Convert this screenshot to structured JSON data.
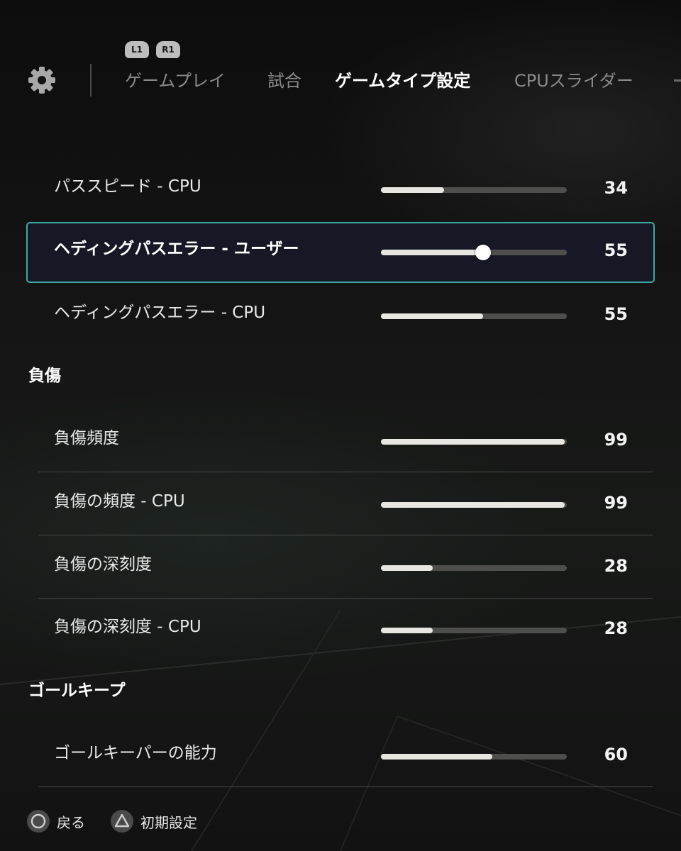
{
  "tabs": {
    "shoulder_left": "L1",
    "shoulder_right": "R1",
    "items": [
      {
        "label": "ゲームプレイ",
        "active": false
      },
      {
        "label": "試合",
        "active": false
      },
      {
        "label": "ゲームタイプ設定",
        "active": true
      },
      {
        "label": "CPUスライダー",
        "active": false
      }
    ]
  },
  "settings": [
    {
      "label": "パススピード - CPU",
      "value": "34",
      "fill": 0.34,
      "selected": false
    },
    {
      "label": "ヘディングパスエラー - ユーザー",
      "value": "55",
      "fill": 0.55,
      "selected": true
    },
    {
      "label": "ヘディングパスエラー - CPU",
      "value": "55",
      "fill": 0.55,
      "selected": false
    }
  ],
  "sections": [
    {
      "title": "負傷",
      "rows": [
        {
          "label": "負傷頻度",
          "value": "99",
          "fill": 0.99
        },
        {
          "label": "負傷の頻度 - CPU",
          "value": "99",
          "fill": 0.99
        },
        {
          "label": "負傷の深刻度",
          "value": "28",
          "fill": 0.28
        },
        {
          "label": "負傷の深刻度 - CPU",
          "value": "28",
          "fill": 0.28
        }
      ]
    },
    {
      "title": "ゴールキープ",
      "rows": [
        {
          "label": "ゴールキーパーの能力",
          "value": "60",
          "fill": 0.6
        }
      ]
    }
  ],
  "footer": {
    "back_label": "戻る",
    "back_icon": "circle-button-icon",
    "reset_label": "初期設定",
    "reset_icon": "triangle-button-icon"
  },
  "colors": {
    "accent_border": "#3fa9a4",
    "slider_fill": "#e8e6e0",
    "slider_track": "#4e4e4c"
  }
}
